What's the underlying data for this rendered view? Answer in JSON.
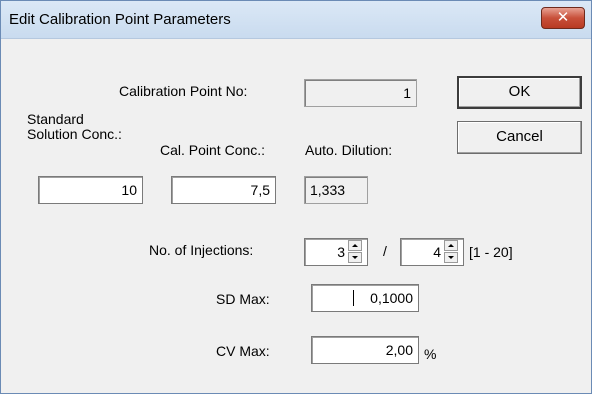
{
  "dialog": {
    "title": "Edit Calibration Point Parameters",
    "close_glyph": "✕"
  },
  "labels": {
    "calibration_point_no": "Calibration Point No:",
    "standard_solution_conc": "Standard Solution Conc.:",
    "cal_point_conc": "Cal. Point Conc.:",
    "auto_dilution": "Auto. Dilution:",
    "no_of_injections": "No. of Injections:",
    "injections_separator": "/",
    "injections_range": "[1 - 20]",
    "sd_max": "SD Max:",
    "cv_max": "CV Max:",
    "percent": "%"
  },
  "values": {
    "calibration_point_no": "1",
    "standard_solution_conc": "10",
    "cal_point_conc": "7,5",
    "auto_dilution": "1,333",
    "injections_min": "3",
    "injections_max": "4",
    "sd_max": "0,1000",
    "cv_max": "2,00"
  },
  "buttons": {
    "ok": "OK",
    "cancel": "Cancel"
  },
  "icons": {
    "close": "close-icon",
    "spinner_up": "spin-up-arrow-icon",
    "spinner_down": "spin-down-arrow-icon"
  },
  "colors": {
    "title_bar": "#c9dbef",
    "close_button": "#c8503a",
    "dialog_bg": "#f0f0f0",
    "field_bg": "#ffffff"
  }
}
